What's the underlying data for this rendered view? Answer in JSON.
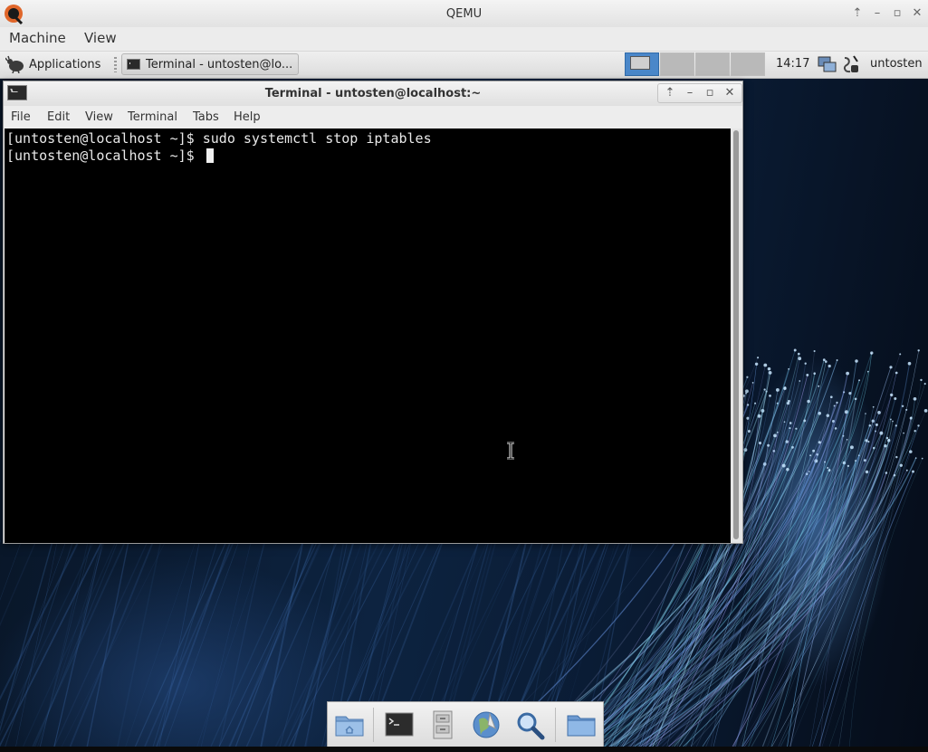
{
  "qemu": {
    "title": "QEMU",
    "menu": [
      "Machine",
      "View"
    ]
  },
  "panel": {
    "applications_label": "Applications",
    "task_label": "Terminal - untosten@lo...",
    "clock": "14:17",
    "user": "untosten"
  },
  "terminal": {
    "title": "Terminal - untosten@localhost:~",
    "menu": [
      "File",
      "Edit",
      "View",
      "Terminal",
      "Tabs",
      "Help"
    ],
    "lines": [
      "[untosten@localhost ~]$ sudo systemctl stop iptables",
      "[untosten@localhost ~]$ "
    ]
  },
  "dock": {
    "items": [
      "home-folder-icon",
      "terminal-icon",
      "file-cabinet-icon",
      "web-browser-icon",
      "search-icon",
      "folder-icon"
    ]
  },
  "colors": {
    "workspace_active": "#4a87c9",
    "terminal_bg": "#000000",
    "terminal_fg": "#e8e8e8"
  }
}
